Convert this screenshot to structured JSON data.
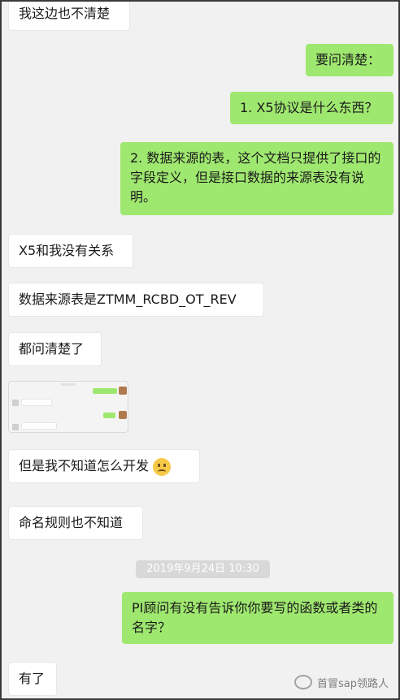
{
  "messages": [
    {
      "side": "in",
      "text": "我这边也不清楚"
    },
    {
      "side": "out",
      "text": "要问清楚："
    },
    {
      "side": "out",
      "text": "1. X5协议是什么东西？"
    },
    {
      "side": "out",
      "text": "2. 数据来源的表，这个文档只提供了接口的字段定义，但是接口数据的来源表没有说明。"
    },
    {
      "side": "in",
      "text": "X5和我没有关系"
    },
    {
      "side": "in",
      "text": "数据来源表是ZTMM_RCBD_OT_REV"
    },
    {
      "side": "in",
      "text": "都问清楚了"
    },
    {
      "side": "in",
      "text": "但是我不知道怎么开发",
      "emoji": "worried-face"
    },
    {
      "side": "in",
      "text": "命名规则也不知道"
    },
    {
      "side": "out",
      "text": "PI顾问有没有告诉你你要写的函数或者类的名字？"
    },
    {
      "side": "in",
      "text": "有了"
    }
  ],
  "timestamp": "2019年9月24日 10:30",
  "watermark": "首冒sap领路人",
  "colors": {
    "outgoing": "#9fe870",
    "incoming": "#ffffff",
    "background": "#f1f1f1"
  }
}
